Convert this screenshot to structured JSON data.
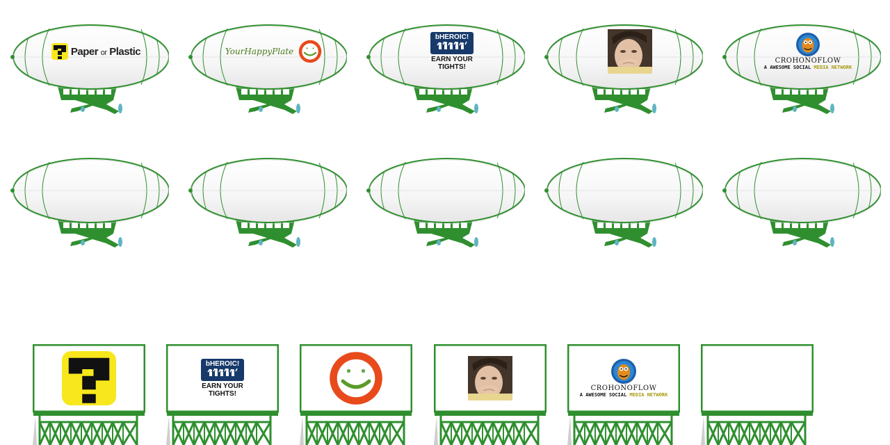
{
  "colors": {
    "accent_green": "#2f8f2f",
    "dark_green": "#1f6e1f",
    "heroic_navy": "#173a6a",
    "plate_orange": "#e84a1b",
    "tagline_gold": "#a79a10"
  },
  "ads": {
    "paper_or_plastic": {
      "name_a": "Paper",
      "name_or": "or",
      "name_b": "Plastic"
    },
    "your_happy_plate": {
      "name": "YourHappyPlate"
    },
    "bheroic": {
      "name_b": "b",
      "name_rest": "HEROIC!",
      "tagline": "EARN YOUR TIGHTS!"
    },
    "crohnoflow": {
      "name": "CROHONOFLOW",
      "tagline_a": "A AWESOME SOCIAL ",
      "tagline_b": "MEDIA NETWORK"
    }
  },
  "blimp_rows": [
    [
      "paper_or_plastic",
      "your_happy_plate",
      "bheroic",
      "photo",
      "crohnoflow"
    ],
    [
      "empty",
      "empty",
      "empty",
      "empty",
      "empty"
    ]
  ],
  "billboards": [
    "paper_or_plastic_icon",
    "bheroic",
    "your_happy_plate_icon",
    "photo",
    "crohnoflow",
    "empty"
  ]
}
